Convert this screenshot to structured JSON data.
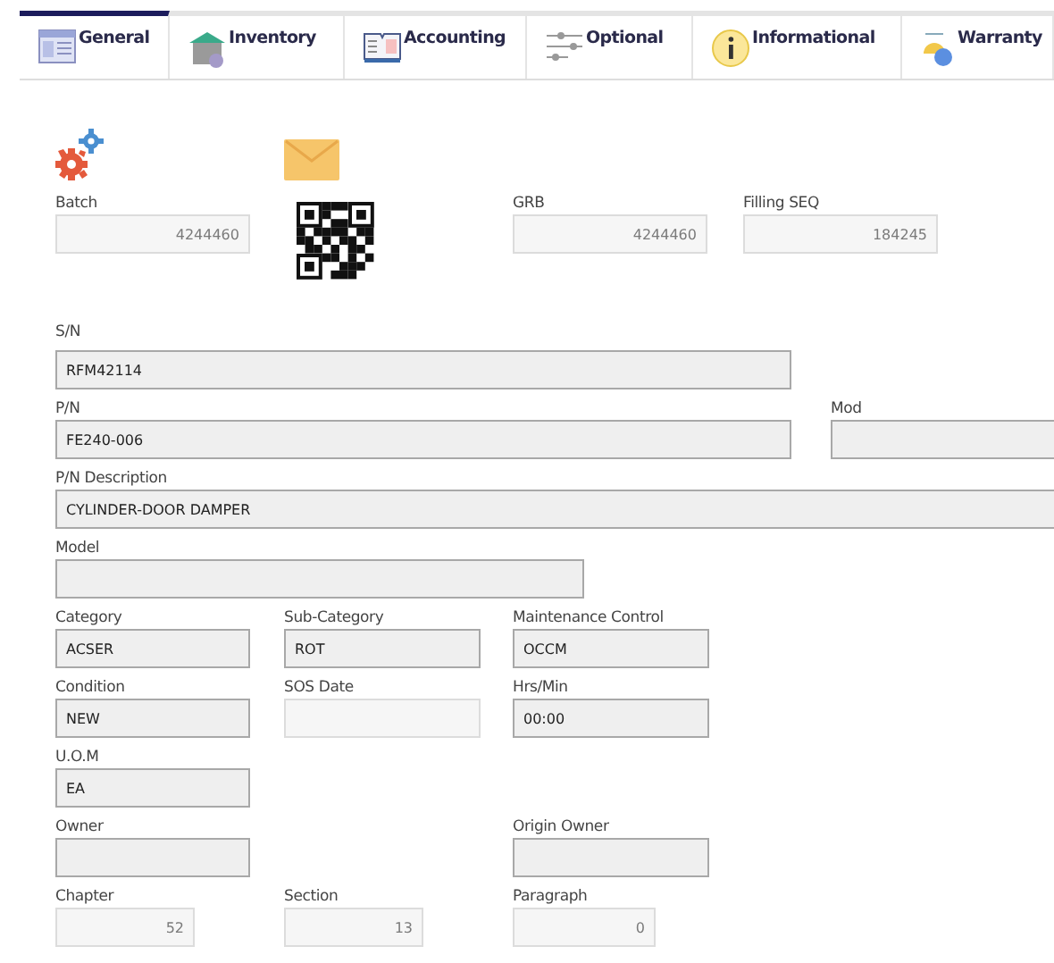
{
  "tabs": [
    {
      "label": "General",
      "selected": true
    },
    {
      "label": "Inventory",
      "selected": false
    },
    {
      "label": "Accounting",
      "selected": false
    },
    {
      "label": "Optional",
      "selected": false
    },
    {
      "label": "Informational",
      "selected": false
    },
    {
      "label": "Warranty",
      "selected": false
    }
  ],
  "rows": [
    [
      {
        "label": "Batch",
        "value": "4244460",
        "disabled": true
      },
      {
        "label": "GRB",
        "value": "4244460",
        "disabled": true
      },
      {
        "label": "Filling SEQ",
        "value": "184245",
        "disabled": true
      }
    ],
    [
      {
        "label": "S/N",
        "value": "RFM42114",
        "disabled": false
      }
    ],
    [
      {
        "label": "P/N",
        "value": "FE240-006",
        "disabled": false
      },
      {
        "label": "Mod",
        "disabled": false
      }
    ],
    [
      {
        "label": "P/N Description",
        "value": "CYLINDER-DOOR DAMPER",
        "disabled": false
      }
    ],
    [
      {
        "label": "Model",
        "disabled": false
      }
    ],
    [
      {
        "label": "Category",
        "value": "ACSER",
        "disabled": false
      },
      {
        "label": "Sub-Category",
        "value": "ROT",
        "disabled": false
      },
      {
        "label": "Maintenance Control",
        "value": "OCCM",
        "disabled": false
      }
    ],
    [
      {
        "label": "Condition",
        "value": "NEW",
        "disabled": false
      },
      {
        "label": "SOS Date",
        "disabled": true
      },
      {
        "label": "Hrs/Min",
        "value": "00:00",
        "disabled": false
      }
    ],
    [
      {
        "label": "U.O.M",
        "value": "EA",
        "disabled": false
      }
    ],
    [
      {
        "label": "Owner",
        "disabled": false
      },
      {
        "label": "Origin Owner",
        "disabled": false
      }
    ],
    [
      {
        "label": "Chapter",
        "value": "52",
        "disabled": true
      },
      {
        "label": "Section",
        "value": "13",
        "disabled": true
      },
      {
        "label": "Paragraph",
        "value": "0",
        "disabled": true
      }
    ]
  ]
}
